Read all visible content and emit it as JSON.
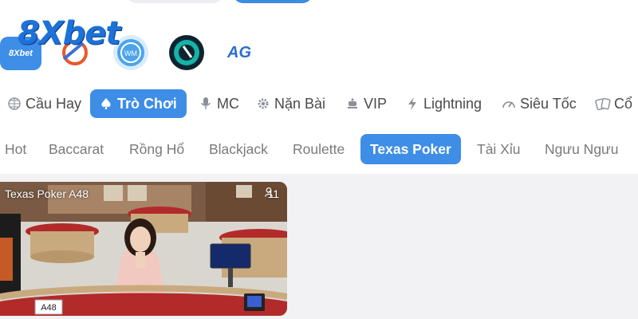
{
  "brand": {
    "logo_text": "8Xbet",
    "provider_1_label": "8Xbet",
    "provider_5_label": "AG"
  },
  "categories": [
    {
      "label": "Cầu Hay",
      "icon": "grid-icon"
    },
    {
      "label": "Trò Chơi",
      "icon": "spade-icon",
      "active": true
    },
    {
      "label": "MC",
      "icon": "microphone-icon"
    },
    {
      "label": "Nặn Bài",
      "icon": "gear-icon"
    },
    {
      "label": "VIP",
      "icon": "crown-icon"
    },
    {
      "label": "Lightning",
      "icon": "lightning-icon"
    },
    {
      "label": "Siêu Tốc",
      "icon": "speedometer-icon"
    },
    {
      "label": "Cổ",
      "icon": "cards-icon"
    }
  ],
  "game_types": [
    {
      "label": "Hot"
    },
    {
      "label": "Baccarat"
    },
    {
      "label": "Rồng Hổ"
    },
    {
      "label": "Blackjack"
    },
    {
      "label": "Roulette"
    },
    {
      "label": "Texas Poker",
      "active": true
    },
    {
      "label": "Tài Xỉu"
    },
    {
      "label": "Ngưu Ngưu"
    }
  ],
  "card": {
    "title": "Texas Poker A48",
    "viewers": "11",
    "table_tag": "A48"
  },
  "colors": {
    "accent": "#3e8de6",
    "text": "#4a4a4a",
    "muted": "#7a7a7a",
    "content_bg": "#f2f2f4"
  }
}
